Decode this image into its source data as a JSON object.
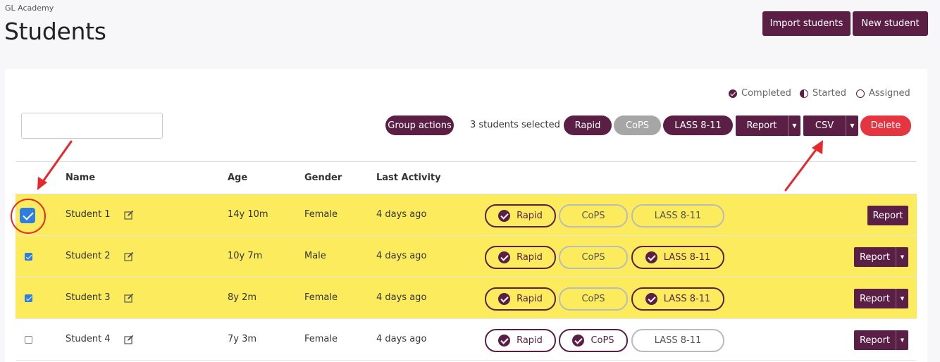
{
  "header": {
    "org": "GL Academy",
    "title": "Students",
    "import_label": "Import students",
    "new_label": "New student"
  },
  "legend": {
    "completed": "Completed",
    "started": "Started",
    "assigned": "Assigned"
  },
  "search": {
    "value": "",
    "placeholder": ""
  },
  "toolbar": {
    "group_actions": "Group actions",
    "selected_text": "3 students selected",
    "rapid": "Rapid",
    "cops": "CoPS",
    "lass": "LASS 8-11",
    "report": "Report",
    "csv": "CSV",
    "delete": "Delete"
  },
  "table": {
    "columns": [
      "Name",
      "Age",
      "Gender",
      "Last Activity"
    ],
    "rows": [
      {
        "name": "Student 1",
        "age": "14y 10m",
        "gender": "Female",
        "last": "4 days ago",
        "checked": true,
        "rapid": "Rapid",
        "cops": "CoPS",
        "lass": "LASS 8-11",
        "report": "Report"
      },
      {
        "name": "Student 2",
        "age": "10y 7m",
        "gender": "Male",
        "last": "4 days ago",
        "checked": true,
        "rapid": "Rapid",
        "cops": "CoPS",
        "lass": "LASS 8-11",
        "report": "Report"
      },
      {
        "name": "Student 3",
        "age": "8y 2m",
        "gender": "Female",
        "last": "4 days ago",
        "checked": true,
        "rapid": "Rapid",
        "cops": "CoPS",
        "lass": "LASS 8-11",
        "report": "Report"
      },
      {
        "name": "Student 4",
        "age": "7y 3m",
        "gender": "Female",
        "last": "4 days ago",
        "checked": false,
        "rapid": "Rapid",
        "cops": "CoPS",
        "lass": "LASS 8-11",
        "report": "Report"
      }
    ]
  },
  "colors": {
    "brand": "#5b1f46",
    "selected_row": "#fcec5d",
    "delete": "#e53540",
    "checkbox": "#2f7de1",
    "annotation": "#e8262b"
  }
}
